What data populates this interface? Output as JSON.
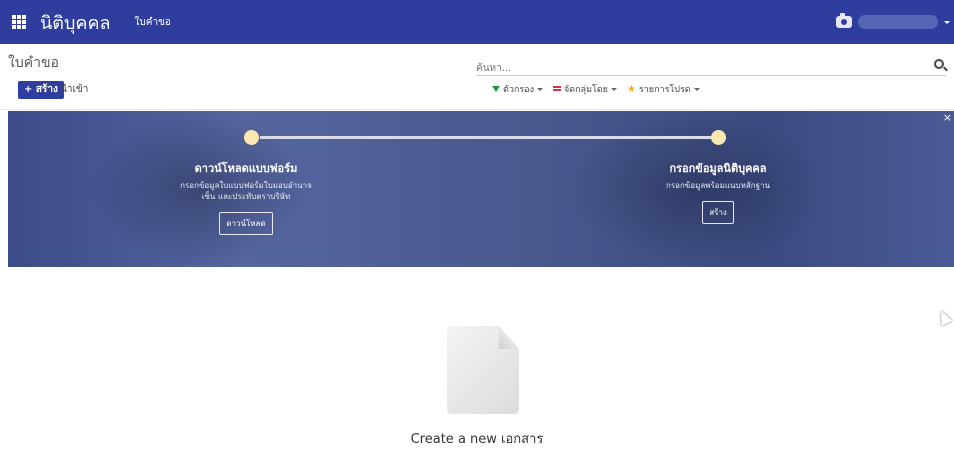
{
  "navbar": {
    "brand": "นิติบุคคล",
    "menu_item": "ใบคำขอ",
    "user_name": ""
  },
  "control": {
    "breadcrumb": "ใบคำขอ",
    "create_label": "+ สร้าง",
    "import_label": "นำเข้า",
    "search_placeholder": "ค้นหา...",
    "filters": [
      {
        "label": "ตัวกรอง",
        "icon": "funnel-icon",
        "color": "#1e9b3a"
      },
      {
        "label": "จัดกลุ่มโดย",
        "icon": "bars-icon",
        "color": "#d6334b"
      },
      {
        "label": "รายการโปรด",
        "icon": "star-icon",
        "color": "#f2b11b"
      }
    ]
  },
  "banner": {
    "close": "×",
    "steps": [
      {
        "title": "ดาวน์โหลดแบบฟอร์ม",
        "desc1": "กรอกข้อมูลใบแบบฟอร์มใบมอบอำนาจ",
        "desc2": "เซ็น และประทับตราบริษัท",
        "button": "ดาวน์โหลด"
      },
      {
        "title": "กรอกข้อมูลนิติบุคคล",
        "desc1": "กรอกข้อมูลพร้อมแนบหลักฐาน",
        "desc2": "",
        "button": "สร้าง"
      }
    ]
  },
  "empty_state": {
    "title": "Create a new เอกสาร"
  },
  "colors": {
    "navbar": "#2f3e9e",
    "step_dot": "#fbe7b0"
  }
}
